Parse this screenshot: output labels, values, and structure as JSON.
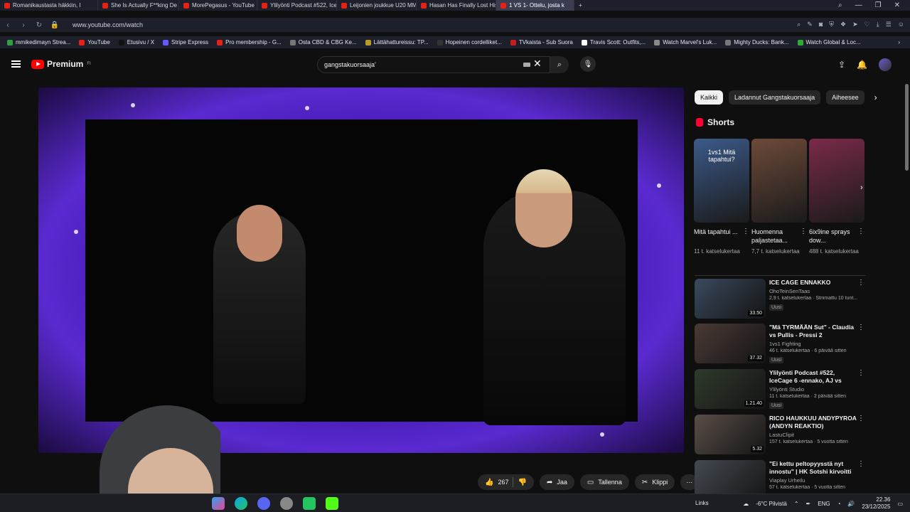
{
  "tabs": [
    {
      "label": "Romanikaustasta häkkiin, I"
    },
    {
      "label": "She Is Actually F**king De"
    },
    {
      "label": "MorePegasus - YouTube"
    },
    {
      "label": "Ylilyönti Podcast #522, Ice"
    },
    {
      "label": "Leijonien joukkue U20 MM"
    },
    {
      "label": "Hasan Has Finally Lost His"
    },
    {
      "label": "1 VS 1- Ottelu, josta k"
    }
  ],
  "browser": {
    "url": "www.youtube.com/watch",
    "bookmarks": [
      "mmikedimayn Strea...",
      "YouTube",
      "Etusivu / X",
      "Stripe Express",
      "Pro membership - G...",
      "Osta CBD & CBG Ke...",
      "Lättähattureissu: TP...",
      "Hopeinen cordelliket...",
      "TVkaista - Sub Suora",
      "Travis Scott: Outfits,...",
      "Watch Marvel's Luk...",
      "Mighty Ducks: Bank...",
      "Watch Global & Loc..."
    ]
  },
  "masthead": {
    "logo_text": "Premium",
    "logo_sup": "FI",
    "search_value": "gangstakuorsaaja'"
  },
  "actions": {
    "likes": "267",
    "share": "Jaa",
    "save": "Tallenna",
    "clip": "Klippi"
  },
  "chips": [
    "Kaikki",
    "Ladannut Gangstakuorsaaja",
    "Aiheesee"
  ],
  "shorts": {
    "heading": "Shorts",
    "items": [
      {
        "title": "Mitä tapahtui ...",
        "views": "11 t. katselukertaa",
        "overlay": "1vs1 Mitä tapahtui?",
        "color": "#3c5a8a"
      },
      {
        "title": "Huomenna paljastetaa...",
        "views": "7,7 t. katselukertaa",
        "overlay": "",
        "color": "#6d4a3a"
      },
      {
        "title": "6ix9ine sprays dow...",
        "views": "488 t. katselukertaa",
        "overlay": "",
        "color": "#7a2a4a"
      }
    ]
  },
  "recommendations": [
    {
      "title": "ICE CAGE ENNAKKO",
      "channel": "OhoTeinSenTaas",
      "meta": "2,9 t. katselukertaa · Striimattu 10 tunt...",
      "badge": "Uusi",
      "duration": "33.50",
      "color": "#3a4a5e"
    },
    {
      "title": "\"Mä TYRMÄÄN Sut\" - Claudia vs Pullis - Pressi 2",
      "channel": "1vs1 Fighting",
      "meta": "46 t. katselukertaa · 6 päivää sitten",
      "badge": "Uusi",
      "duration": "37.32",
      "color": "#4a3a36"
    },
    {
      "title": "Ylilyönti Podcast #522, IceCage 6 -ennako, AJ vs Paul, 1vs1...",
      "channel": "Ylilyönti Studio",
      "meta": "11 t. katselukertaa · 2 päivää sitten",
      "badge": "Uusi",
      "duration": "1.21.40",
      "color": "#2f3a2c"
    },
    {
      "title": "RICO HAUKKUU ANDYPYROA (ANDYN REAKTIO)",
      "channel": "LastuClipit",
      "meta": "157 t. katselukertaa · 5 vuotta sitten",
      "badge": "",
      "duration": "5.32",
      "color": "#5a4e48"
    },
    {
      "title": "\"Ei kettu peltopyysstä nyt innostu\" | HK Sotshi kirvoitti ...",
      "channel": "Viaplay Urheilu",
      "meta": "57 t. katselukertaa · 5 vuotta sitten",
      "badge": "",
      "duration": "",
      "color": "#444a52"
    }
  ],
  "taskbar": {
    "links": "Links",
    "weather": "-6°C  Pilvistä",
    "lang": "ENG",
    "time": "22.36",
    "date": "23/12/2025"
  }
}
